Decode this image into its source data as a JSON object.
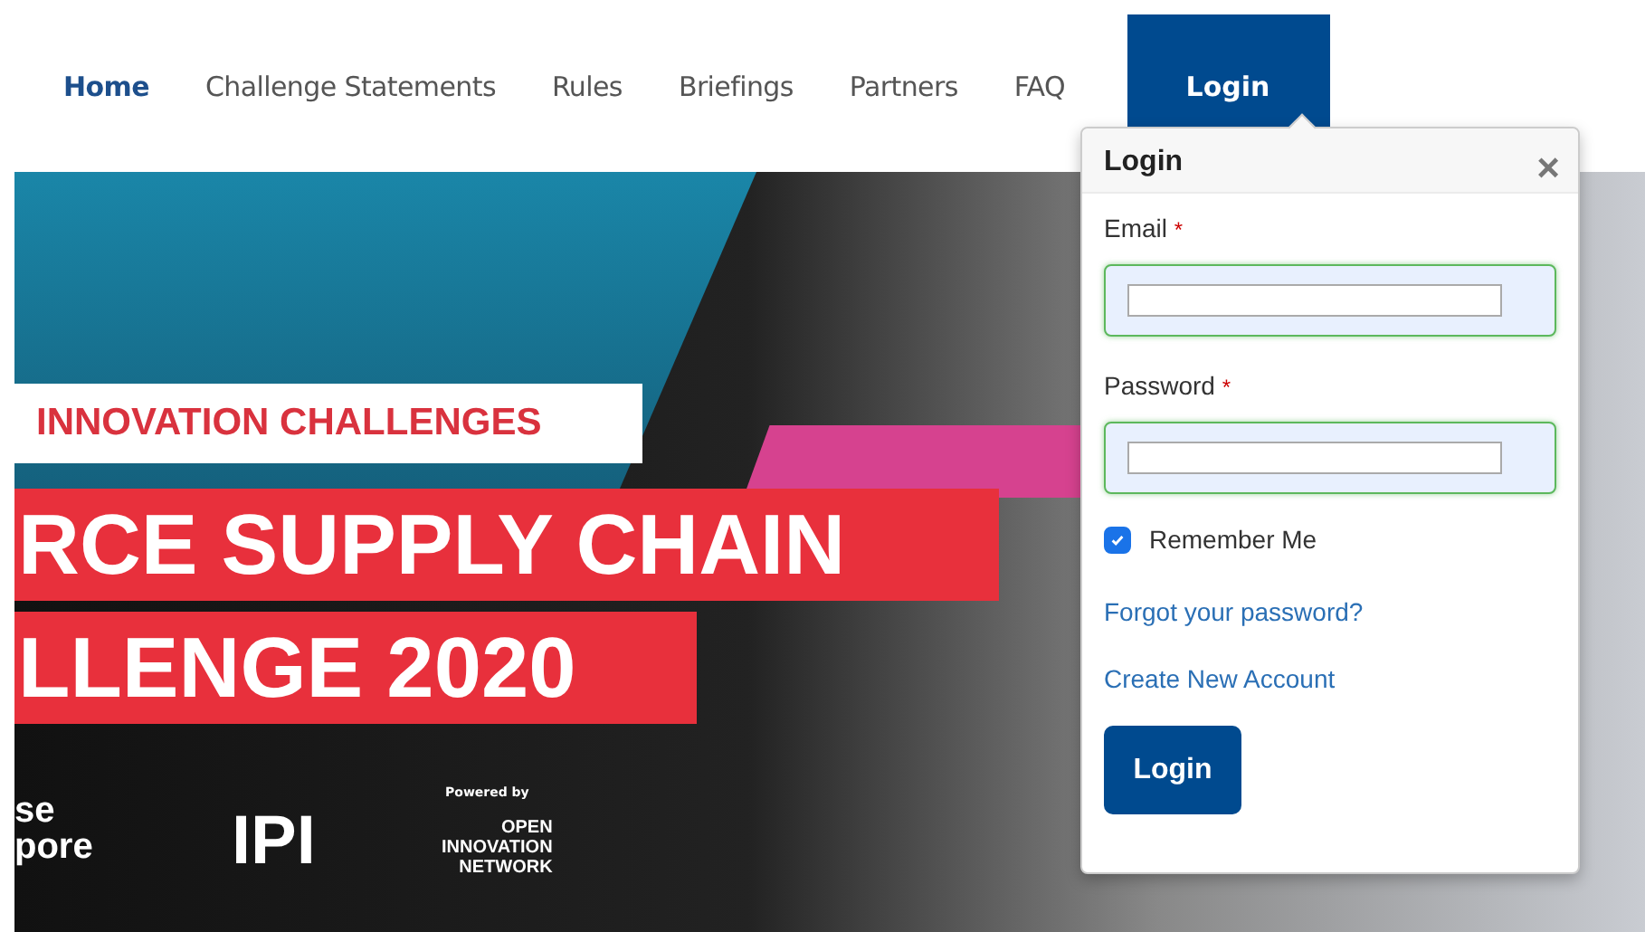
{
  "nav": {
    "items": [
      {
        "label": "Home",
        "selected": true
      },
      {
        "label": "Challenge Statements",
        "selected": false
      },
      {
        "label": "Rules",
        "selected": false
      },
      {
        "label": "Briefings",
        "selected": false
      },
      {
        "label": "Partners",
        "selected": false
      },
      {
        "label": "FAQ",
        "selected": false
      }
    ],
    "login_tab": {
      "label": "Login",
      "expanded": true
    }
  },
  "banner": {
    "tagline": "INNOVATION CHALLENGES",
    "title_lines": [
      "RCE SUPPLY CHAIN",
      "LLENGE 2020"
    ],
    "logos": {
      "left": [
        "se",
        "pore"
      ],
      "middle": "IPI",
      "powered_by": "Powered by",
      "network": [
        "OPEN",
        "INNOVATION",
        "NETWORK"
      ]
    }
  },
  "login_popup": {
    "title": "Login",
    "close": "×",
    "fields": [
      {
        "label": "Email",
        "required_mark": "*"
      },
      {
        "label": "Password",
        "required_mark": "*"
      }
    ],
    "remember": {
      "label": "Remember Me",
      "checked": true
    },
    "links": [
      "Forgot your password?",
      "Create New Account"
    ],
    "submit": "Login"
  }
}
